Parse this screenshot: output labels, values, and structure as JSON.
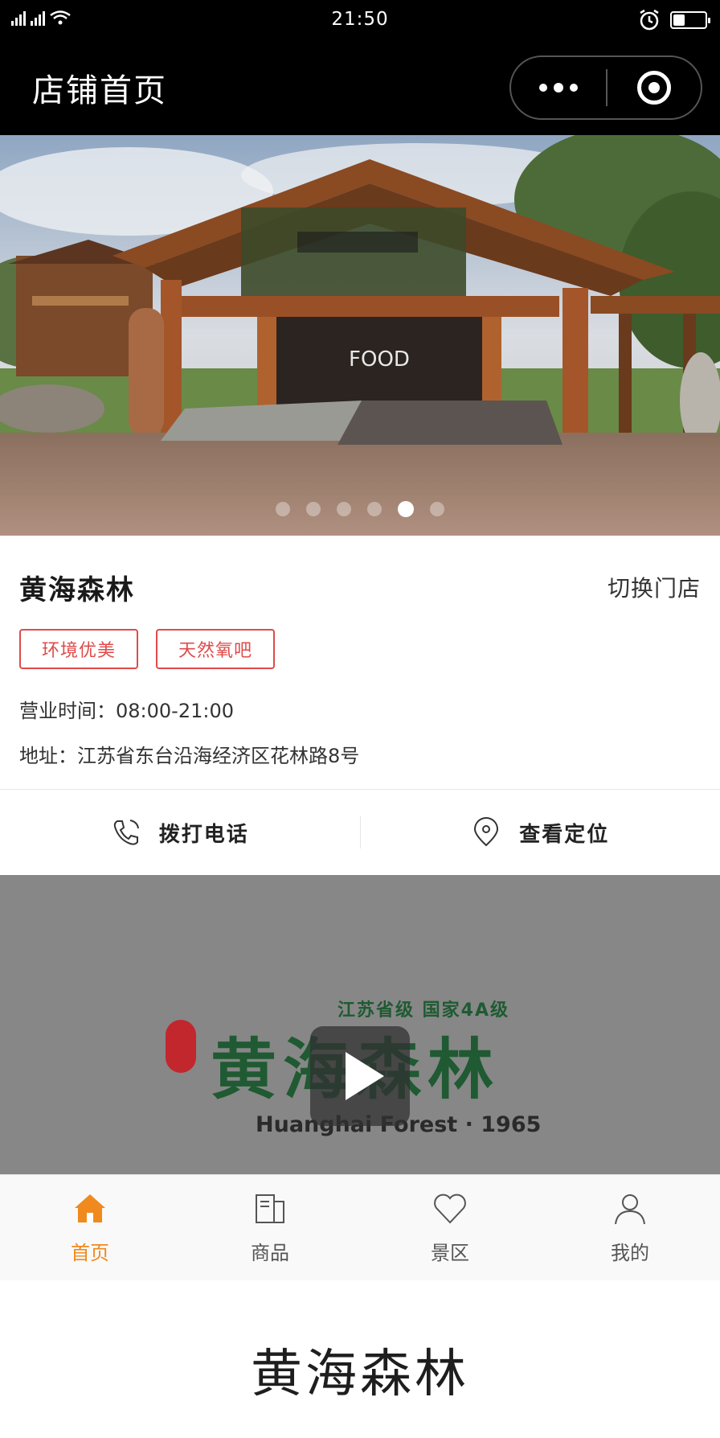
{
  "status_bar": {
    "time": "21:50"
  },
  "nav": {
    "title": "店铺首页"
  },
  "banner": {
    "sign_text": "FOOD",
    "slides_count": 6,
    "active_slide": 5
  },
  "store": {
    "name": "黄海森林",
    "switch_label": "切换门店",
    "tags": [
      "环境优美",
      "天然氧吧"
    ],
    "hours": "营业时间：08:00-21:00",
    "address": "地址：江苏省东台沿海经济区花林路8号"
  },
  "actions": {
    "call_label": "拨打电话",
    "location_label": "查看定位"
  },
  "video": {
    "tagline": "江苏省级 国家4A级",
    "logo_text": "黄海森林",
    "english_text": "Huanghai Forest · 1965"
  },
  "tabs": [
    {
      "label": "首页",
      "icon": "home-icon",
      "active": true
    },
    {
      "label": "商品",
      "icon": "goods-icon",
      "active": false
    },
    {
      "label": "景区",
      "icon": "heart-icon",
      "active": false
    },
    {
      "label": "我的",
      "icon": "user-icon",
      "active": false
    }
  ],
  "footer": {
    "brand": "黄海森林"
  },
  "colors": {
    "accent": "#f08a1e",
    "tag_red": "#e04a4a",
    "logo_green": "#1f5a32"
  }
}
